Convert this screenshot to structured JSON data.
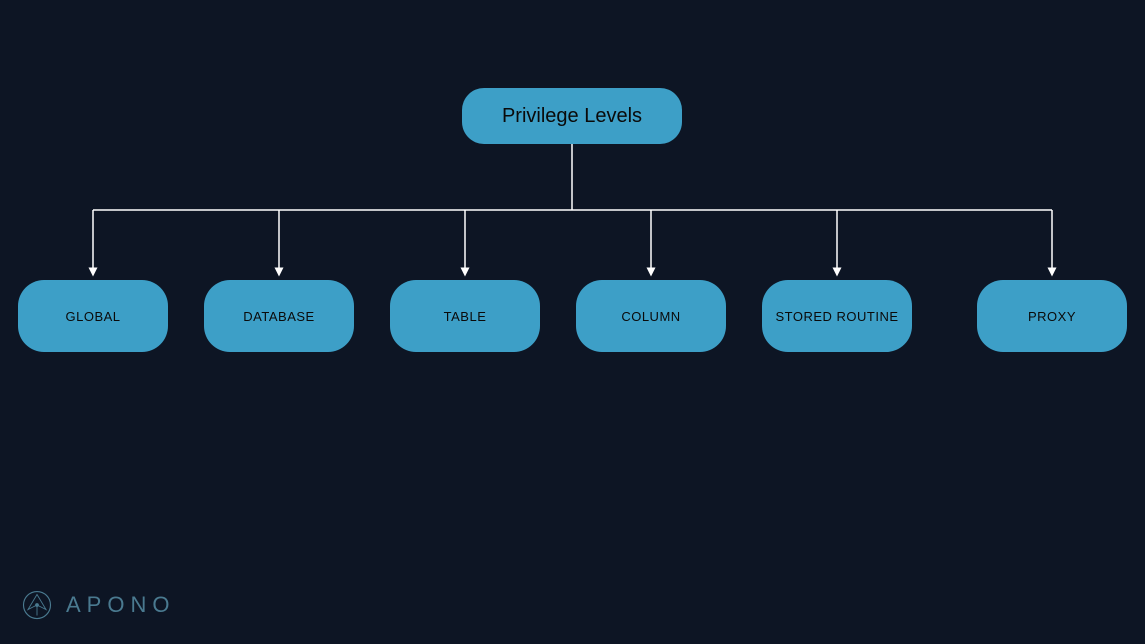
{
  "diagram": {
    "root": {
      "label": "Privilege Levels"
    },
    "children": [
      {
        "label": "GLOBAL"
      },
      {
        "label": "DATABASE"
      },
      {
        "label": "TABLE"
      },
      {
        "label": "COLUMN"
      },
      {
        "label": "STORED ROUTINE"
      },
      {
        "label": "PROXY"
      }
    ]
  },
  "branding": {
    "name": "APONO"
  },
  "colors": {
    "background": "#0d1524",
    "node": "#3d9fc7",
    "connector": "#ffffff",
    "brand": "#4a7a90"
  }
}
